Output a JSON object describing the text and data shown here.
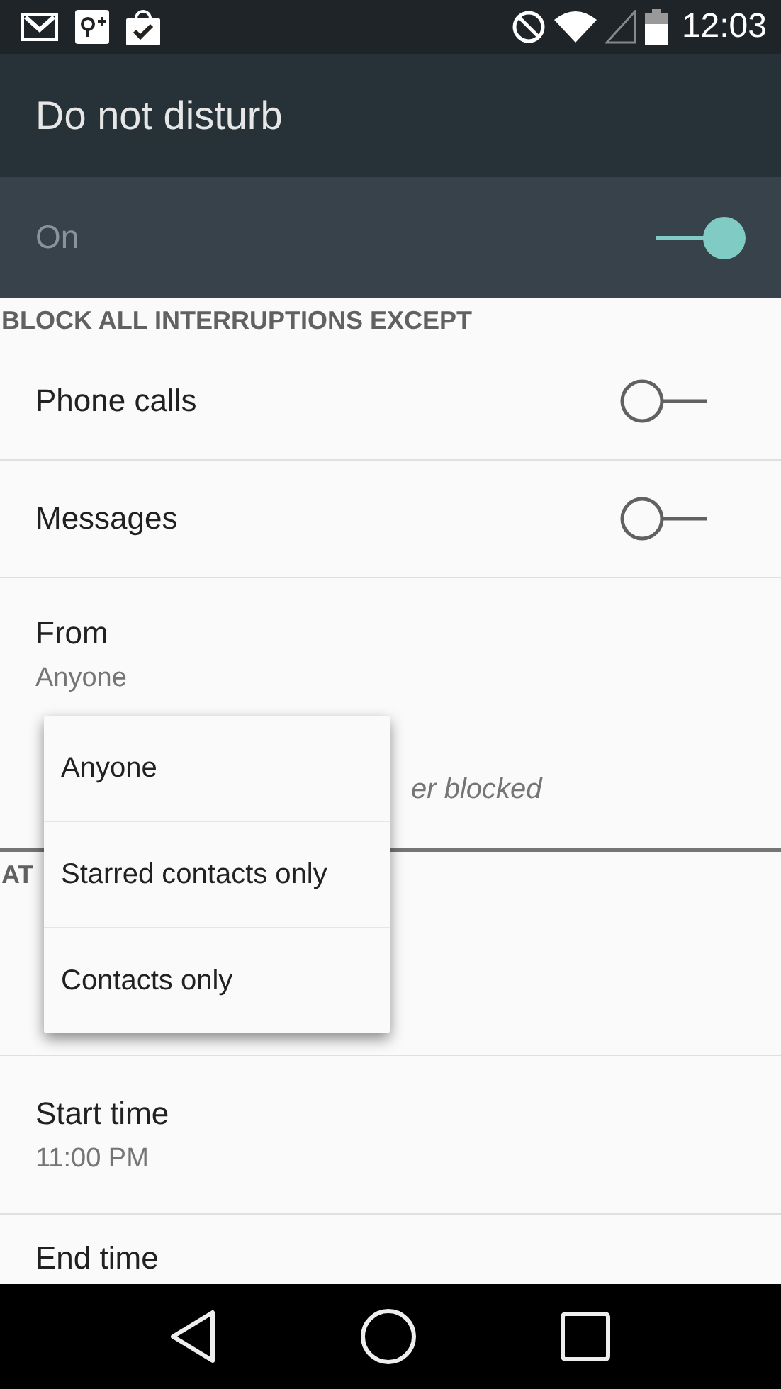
{
  "status_bar": {
    "time": "12:03"
  },
  "toolbar": {
    "title": "Do not disturb"
  },
  "master": {
    "label": "On",
    "on": true
  },
  "sections": [
    {
      "header": "BLOCK ALL INTERRUPTIONS EXCEPT",
      "rows": [
        {
          "kind": "switch",
          "title": "Phone calls",
          "on": false
        },
        {
          "kind": "switch",
          "title": "Messages",
          "on": false
        },
        {
          "kind": "detail",
          "title": "From",
          "subtitle": "Anyone"
        },
        {
          "kind": "note",
          "text": "er blocked"
        }
      ]
    },
    {
      "header": "AT",
      "rows": [
        {
          "kind": "covered"
        },
        {
          "kind": "detail",
          "title": "Start time",
          "subtitle": "11:00 PM"
        },
        {
          "kind": "end",
          "title": "End time"
        }
      ]
    }
  ],
  "popup_menu": {
    "items": [
      "Anyone",
      "Starred contacts only",
      "Contacts only"
    ]
  }
}
